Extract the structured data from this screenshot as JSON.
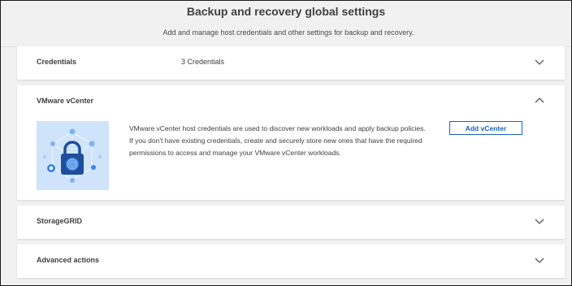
{
  "header": {
    "title": "Backup and recovery global settings",
    "subtitle": "Add and manage host credentials and other settings for backup and recovery."
  },
  "panels": {
    "credentials": {
      "title": "Credentials",
      "value": "3 Credentials",
      "expanded": false
    },
    "vmware": {
      "title": "VMware vCenter",
      "expanded": true,
      "description": "VMware vCenter host credentials are used to discover new workloads and apply backup policies. If you don't have existing credentials, create and securely store new ones that have the required permissions to access and manage your VMware vCenter workloads.",
      "button_label": "Add vCenter",
      "illustration": "padlock-fingerprint-icon"
    },
    "storagegrid": {
      "title": "StorageGRID",
      "expanded": false
    },
    "advanced": {
      "title": "Advanced actions",
      "expanded": false
    }
  },
  "colors": {
    "accent": "#1a62c4",
    "illustration_bg": "#cfe3fb",
    "page_bg": "#f1f1f1"
  }
}
